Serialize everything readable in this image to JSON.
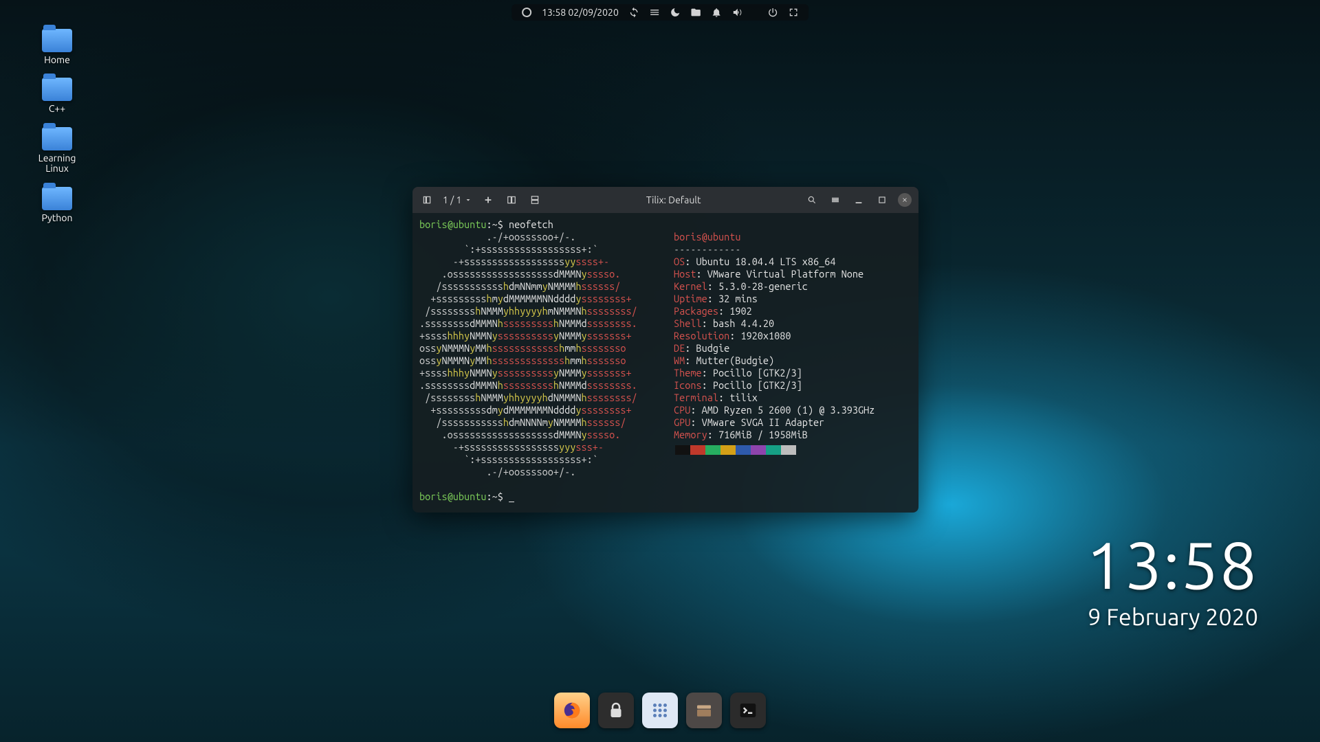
{
  "top_panel": {
    "datetime": "13:58 02/09/2020"
  },
  "desktop_icons": [
    {
      "label": "Home"
    },
    {
      "label": "C++"
    },
    {
      "label": "Learning\nLinux"
    },
    {
      "label": "Python"
    }
  ],
  "desktop_clock": {
    "time": "13:58",
    "date": "9 February 2020"
  },
  "terminal": {
    "title": "Tilix: Default",
    "session_indicator": "1 / 1",
    "prompt_user": "boris@ubuntu",
    "prompt_path": ":~$",
    "command": "neofetch",
    "info_header": "boris@ubuntu",
    "info_divider": "------------",
    "info": {
      "OS": "Ubuntu 18.04.4 LTS x86_64",
      "Host": "VMware Virtual Platform None",
      "Kernel": "5.3.0-28-generic",
      "Uptime": "32 mins",
      "Packages": "1902",
      "Shell": "bash 4.4.20",
      "Resolution": "1920x1080",
      "DE": "Budgie",
      "WM": "Mutter(Budgie)",
      "Theme": "Pocillo [GTK2/3]",
      "Icons": "Pocillo [GTK2/3]",
      "Terminal": "tilix",
      "CPU": "AMD Ryzen 5 2600 (1) @ 3.393GHz",
      "GPU": "VMware SVGA II Adapter",
      "Memory": "716MiB / 1958MiB"
    },
    "ascii": [
      "            .-/+oossssoo+/-.",
      "        `:+ssssssssssssssssss+:`",
      "      -+ssssssssssssssssssyyssss+-",
      "    .ossssssssssssssssssdMMMNysssso.",
      "   /ssssssssssshdmNNmmyNMMMMhssssss/",
      "  +ssssssssshmydMMMMMMNNddddyssssssss+",
      " /sssssssshNMMMyhhyyyyhmNMMMNhssssssss/",
      ".ssssssssdMMMNhssssssssshNMMMdssssssss.",
      "+sssshhhyNMMNyssssssssssyNMMMysssssss+",
      "ossyNMMMNyMMhsssssssssssshmmhssssssso",
      "ossyNMMMNyMMhssssssssssssshmmhsssssso",
      "+sssshhhyNMMNyssssssssssyNMMMysssssss+",
      ".ssssssssdMMMNhssssssssshNMMMdssssssss.",
      " /sssssssshNMMMyhhyyyyhdNMMMNhssssssss/",
      "  +sssssssssdmydMMMMMMMNddddyssssssss+",
      "   /ssssssssssshdmNNNNmyNMMMMhssssss/",
      "    .ossssssssssssssssssdMMMNysssso.",
      "      -+sssssssssssssssssyyysss+-",
      "        `:+ssssssssssssssssss+:`",
      "            .-/+oossssoo+/-."
    ],
    "swatches": [
      "#111",
      "#c0392b",
      "#27ae60",
      "#d4a017",
      "#2e5aac",
      "#8e44ad",
      "#16a085",
      "#bdbdbd"
    ]
  },
  "dock": [
    {
      "name": "firefox"
    },
    {
      "name": "keyring"
    },
    {
      "name": "apps-grid"
    },
    {
      "name": "files"
    },
    {
      "name": "terminal"
    }
  ]
}
